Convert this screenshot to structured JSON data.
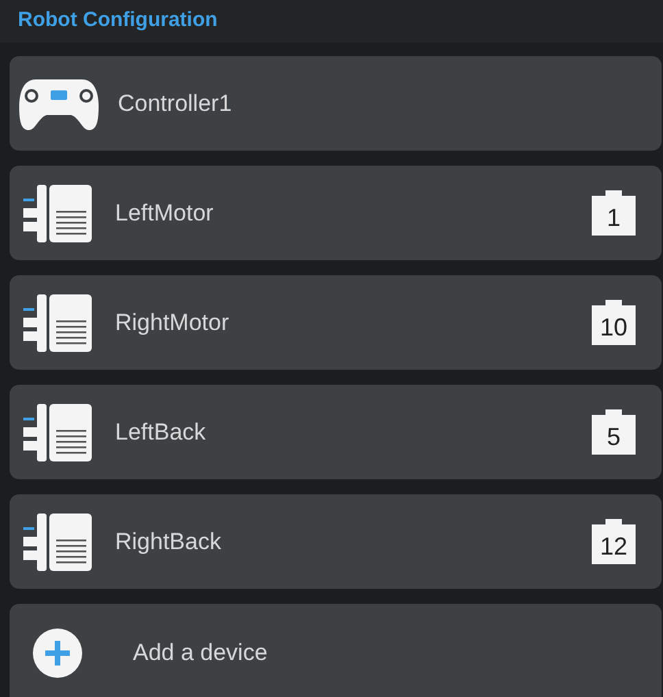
{
  "header": {
    "title": "Robot Configuration"
  },
  "devices": [
    {
      "kind": "controller",
      "name": "Controller1"
    },
    {
      "kind": "motor",
      "name": "LeftMotor",
      "port": "1"
    },
    {
      "kind": "motor",
      "name": "RightMotor",
      "port": "10"
    },
    {
      "kind": "motor",
      "name": "LeftBack",
      "port": "5"
    },
    {
      "kind": "motor",
      "name": "RightBack",
      "port": "12"
    }
  ],
  "add_button": {
    "label": "Add a device"
  }
}
